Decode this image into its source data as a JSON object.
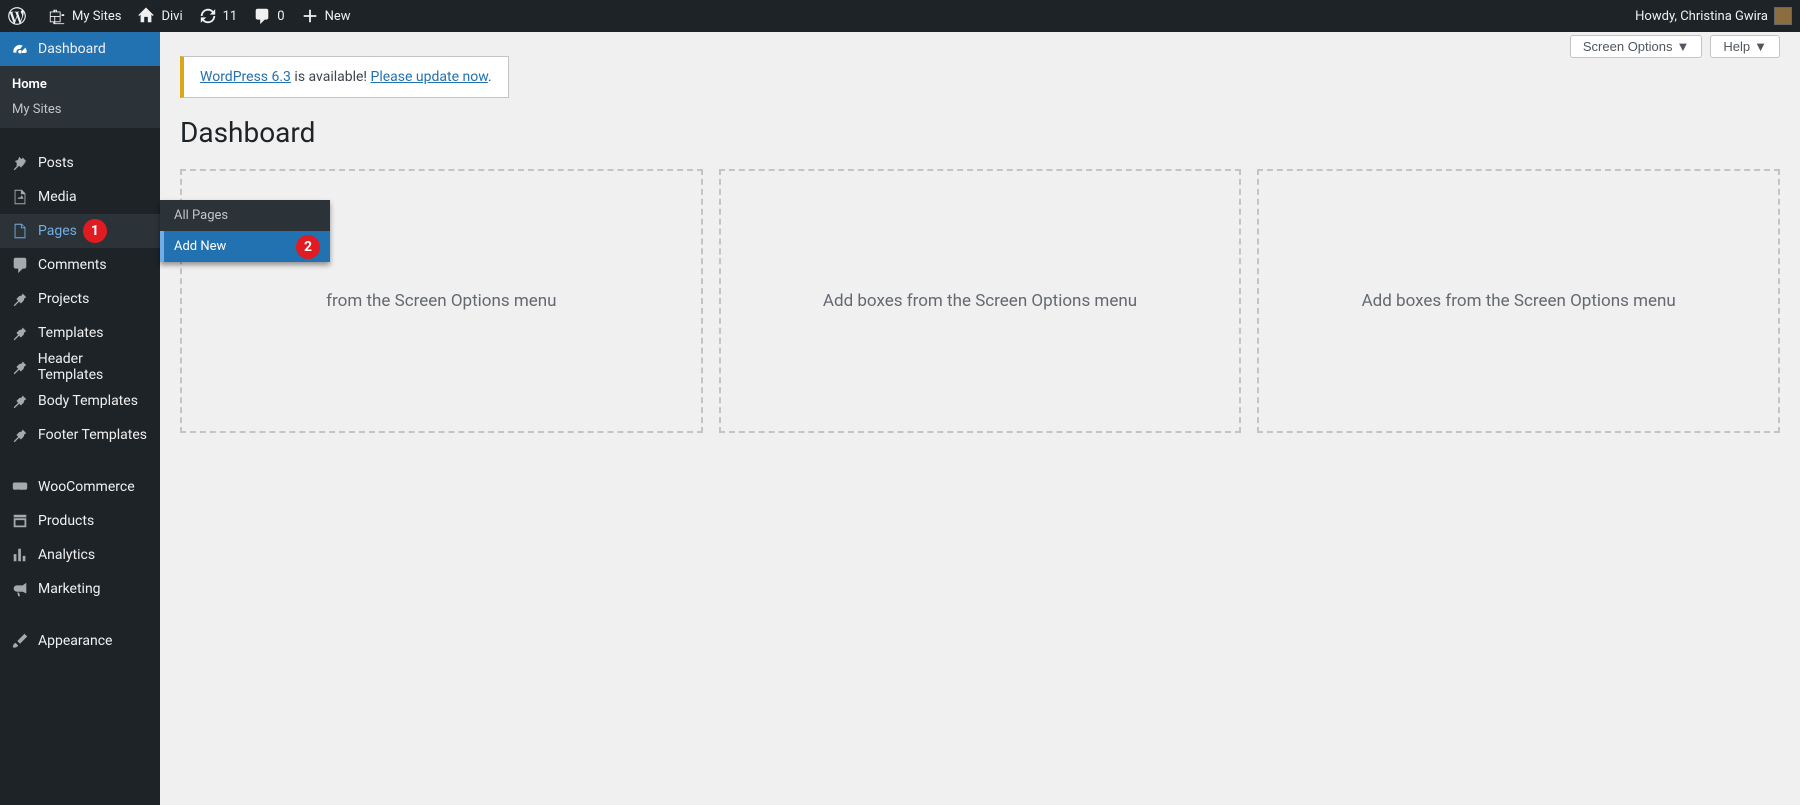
{
  "adminbar": {
    "my_sites": "My Sites",
    "site_name": "Divi",
    "updates_count": "11",
    "comments_count": "0",
    "new": "New",
    "howdy": "Howdy, Christina Gwira"
  },
  "sidebar": {
    "dashboard": "Dashboard",
    "submenu_dashboard": {
      "home": "Home",
      "my_sites": "My Sites"
    },
    "posts": "Posts",
    "media": "Media",
    "pages": "Pages",
    "comments": "Comments",
    "projects": "Projects",
    "templates": "Templates",
    "header_templates": "Header Templates",
    "body_templates": "Body Templates",
    "footer_templates": "Footer Templates",
    "woocommerce": "WooCommerce",
    "products": "Products",
    "analytics": "Analytics",
    "marketing": "Marketing",
    "appearance": "Appearance"
  },
  "flyout": {
    "all_pages": "All Pages",
    "add_new": "Add New"
  },
  "annotations": {
    "badge1": "1",
    "badge2": "2"
  },
  "content": {
    "screen_options": "Screen Options",
    "help": "Help",
    "notice_link1": "WordPress 6.3",
    "notice_mid": " is available! ",
    "notice_link2": "Please update now",
    "notice_end": ".",
    "page_title": "Dashboard",
    "widget_placeholder": "Add boxes from the Screen Options menu",
    "widget_placeholder_partial": "from the Screen Options menu"
  }
}
